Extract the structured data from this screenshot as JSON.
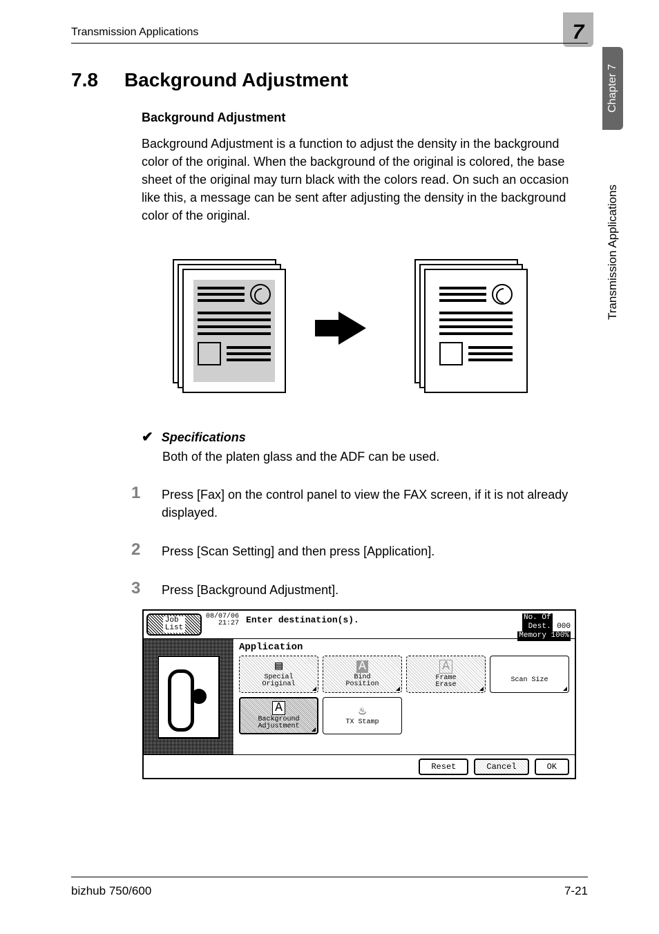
{
  "header": {
    "running_head": "Transmission Applications",
    "chapter_big_number": "7"
  },
  "side_tabs": {
    "dark": "Chapter 7",
    "light": "Transmission Applications"
  },
  "section": {
    "number": "7.8",
    "title": "Background Adjustment",
    "subheading": "Background Adjustment",
    "paragraph": "Background Adjustment is a function to adjust the density in the background color of the original. When the background of the original is colored, the base sheet of the original may turn black with the colors read. On such an occasion like this, a message can be sent after adjusting the density in the background color of the original."
  },
  "spec": {
    "checkmark": "✔",
    "label": "Specifications",
    "text": "Both of the platen glass and the ADF can be used."
  },
  "steps": [
    {
      "num": "1",
      "text": "Press [Fax] on the control panel to view the FAX screen, if it is not already displayed."
    },
    {
      "num": "2",
      "text": "Press [Scan Setting] and then press [Application]."
    },
    {
      "num": "3",
      "text": "Press [Background Adjustment]."
    }
  ],
  "lcd": {
    "job_list": "Job\nList",
    "datetime_date": "08/07/06",
    "datetime_time": "21:27",
    "message": "Enter destination(s).",
    "dest_label": "No. Of\nDest.",
    "dest_count": "000",
    "memory": "Memory 100%",
    "application": "Application",
    "buttons": {
      "special_original": "Special\nOriginal",
      "bind_position": "Bind\nPosition",
      "frame_erase": "Frame\nErase",
      "scan_size": "Scan Size",
      "background_adjustment": "Background\nAdjustment",
      "tx_stamp": "TX Stamp"
    },
    "bottom": {
      "reset": "Reset",
      "cancel": "Cancel",
      "ok": "OK"
    }
  },
  "footer": {
    "left": "bizhub 750/600",
    "right": "7-21"
  }
}
